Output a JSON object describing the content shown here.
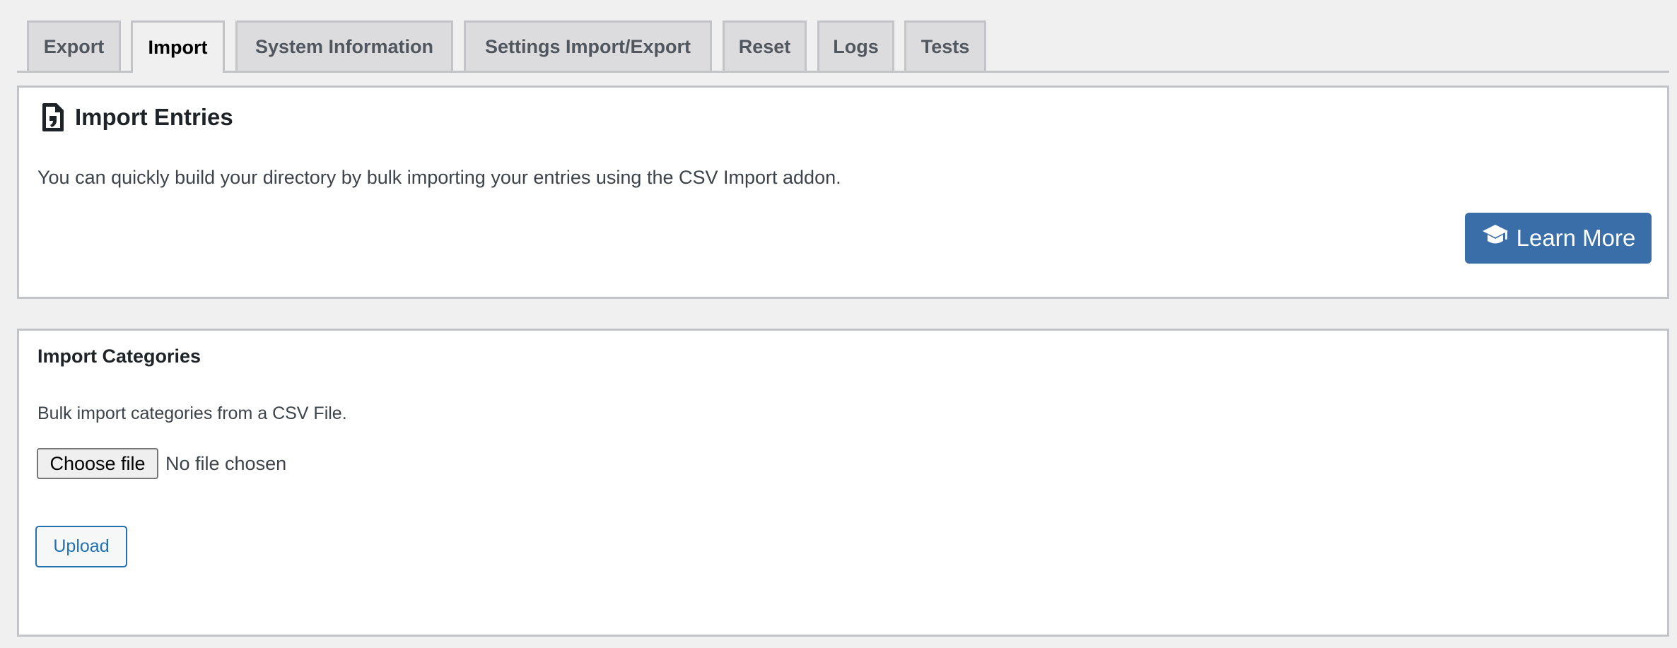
{
  "tabs": [
    {
      "label": "Export",
      "active": false
    },
    {
      "label": "Import",
      "active": true
    },
    {
      "label": "System Information",
      "active": false
    },
    {
      "label": "Settings Import/Export",
      "active": false
    },
    {
      "label": "Reset",
      "active": false
    },
    {
      "label": "Logs",
      "active": false
    },
    {
      "label": "Tests",
      "active": false
    }
  ],
  "import_entries": {
    "icon": "file-import-icon",
    "title": "Import Entries",
    "description": "You can quickly build your directory by bulk importing your entries using the CSV Import addon.",
    "learn_more": {
      "label": "Learn More",
      "icon": "graduation-cap-icon"
    }
  },
  "import_categories": {
    "title": "Import Categories",
    "description": "Bulk import categories from a CSV File.",
    "file_input": {
      "button_label": "Choose file",
      "status": "No file chosen"
    },
    "upload_label": "Upload"
  },
  "colors": {
    "accent": "#3a6ea9",
    "link": "#2271b1",
    "page_bg": "#f0f0f1",
    "tab_bg": "#dcdcde",
    "border": "#c3c4c7"
  }
}
